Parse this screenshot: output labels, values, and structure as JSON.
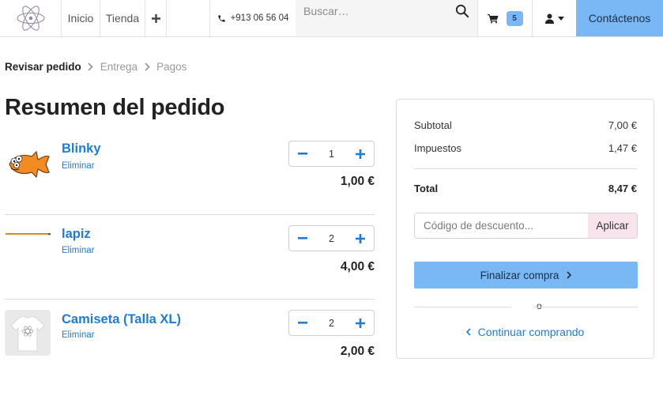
{
  "nav": {
    "home": "Inicio",
    "shop": "Tienda",
    "phone": "+913 06 56 04",
    "search_placeholder": "Buscar…",
    "cart_count": "5",
    "contact": "Contáctenos"
  },
  "breadcrumb": {
    "steps": [
      "Revisar pedido",
      "Entrega",
      "Pagos"
    ],
    "active_step": "Revisar pedido"
  },
  "order": {
    "title": "Resumen del pedido",
    "remove_label": "Eliminar",
    "items": [
      {
        "name": "Blinky",
        "qty": "1",
        "price": "1,00 €",
        "thumbnail_icon": "three-eyed-fish"
      },
      {
        "name": "lapiz",
        "qty": "2",
        "price": "4,00 €",
        "thumbnail_icon": "pencil"
      },
      {
        "name": "Camiseta (Talla XL)",
        "qty": "2",
        "price": "2,00 €",
        "thumbnail_icon": "t-shirt"
      }
    ]
  },
  "summary": {
    "subtotal_label": "Subtotal",
    "subtotal_value": "7,00 €",
    "tax_label": "Impuestos",
    "tax_value": "1,47 €",
    "total_label": "Total",
    "total_value": "8,47 €",
    "discount_placeholder": "Código de descuento...",
    "apply_label": "Aplicar",
    "checkout_label": "Finalizar compra",
    "or_label": "o",
    "continue_label": "Continuar comprando"
  },
  "colors": {
    "accent": "#7ab8f5",
    "link": "#1f7bd8",
    "apply_bg": "#f9e4ee"
  }
}
